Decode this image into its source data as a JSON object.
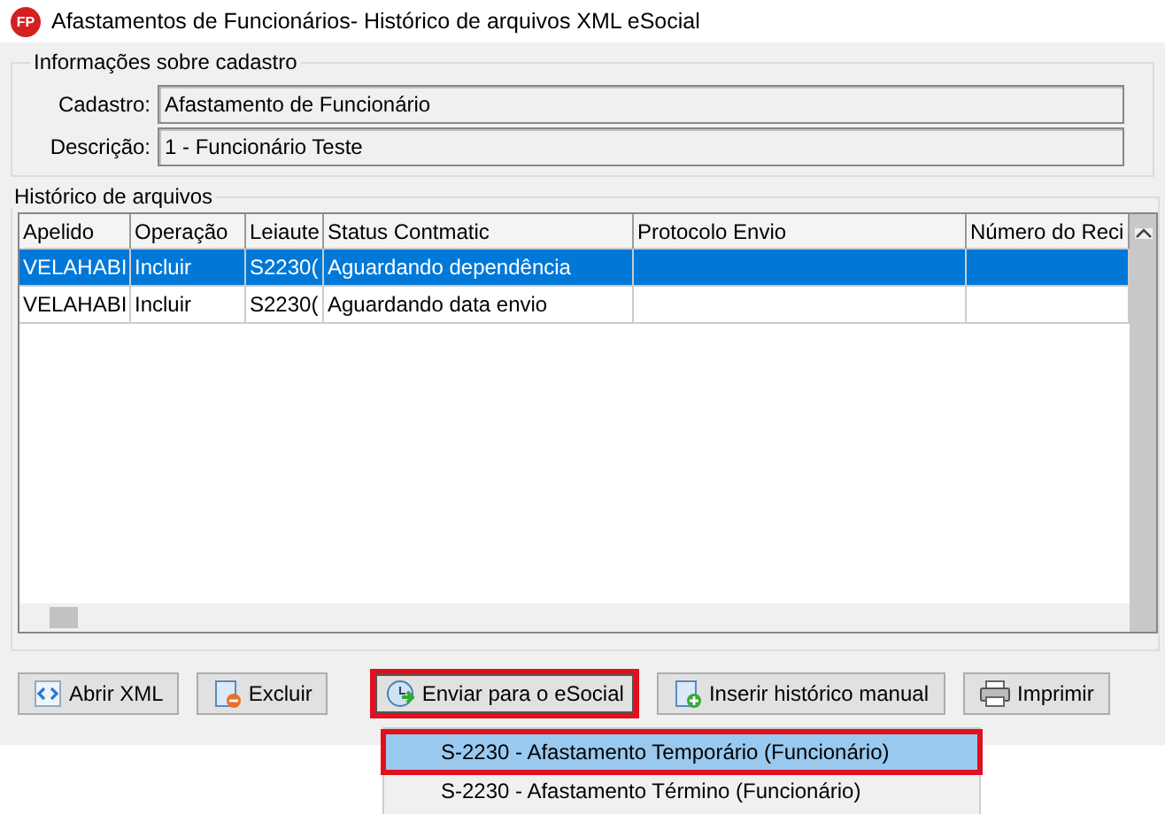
{
  "window": {
    "title": "Afastamentos de Funcionários- Histórico de arquivos XML eSocial",
    "logo": "FP"
  },
  "info": {
    "title": "Informações sobre cadastro",
    "fields": [
      {
        "label": "Cadastro:",
        "value": "Afastamento de Funcionário"
      },
      {
        "label": "Descrição:",
        "value": "1 - Funcionário Teste"
      }
    ]
  },
  "history": {
    "title": "Histórico de arquivos",
    "columns": [
      "Apelido",
      "Operação",
      "Leiaute",
      "Status Contmatic",
      "Protocolo Envio",
      "Número do Reci"
    ],
    "rows": [
      {
        "selected": true,
        "cells": [
          "VELAHABI",
          "Incluir",
          "S2230(",
          "Aguardando dependência",
          "",
          ""
        ]
      },
      {
        "selected": false,
        "cells": [
          "VELAHABI",
          "Incluir",
          "S2230(",
          "Aguardando data envio",
          "",
          ""
        ]
      }
    ]
  },
  "buttons": [
    {
      "label": "Abrir XML",
      "kind": "xml",
      "highlighted": false
    },
    {
      "label": "Excluir",
      "kind": "delete",
      "highlighted": false
    },
    {
      "label": "Enviar para o eSocial",
      "kind": "send",
      "highlighted": true
    },
    {
      "label": "Inserir histórico manual",
      "kind": "add",
      "highlighted": false
    },
    {
      "label": "Imprimir",
      "kind": "print",
      "highlighted": false
    }
  ],
  "menu": [
    {
      "label": "S-2230 - Afastamento Temporário (Funcionário)",
      "selected": true,
      "highlighted": true
    },
    {
      "label": "S-2230 - Afastamento Término (Funcionário)",
      "selected": false,
      "highlighted": false
    }
  ]
}
